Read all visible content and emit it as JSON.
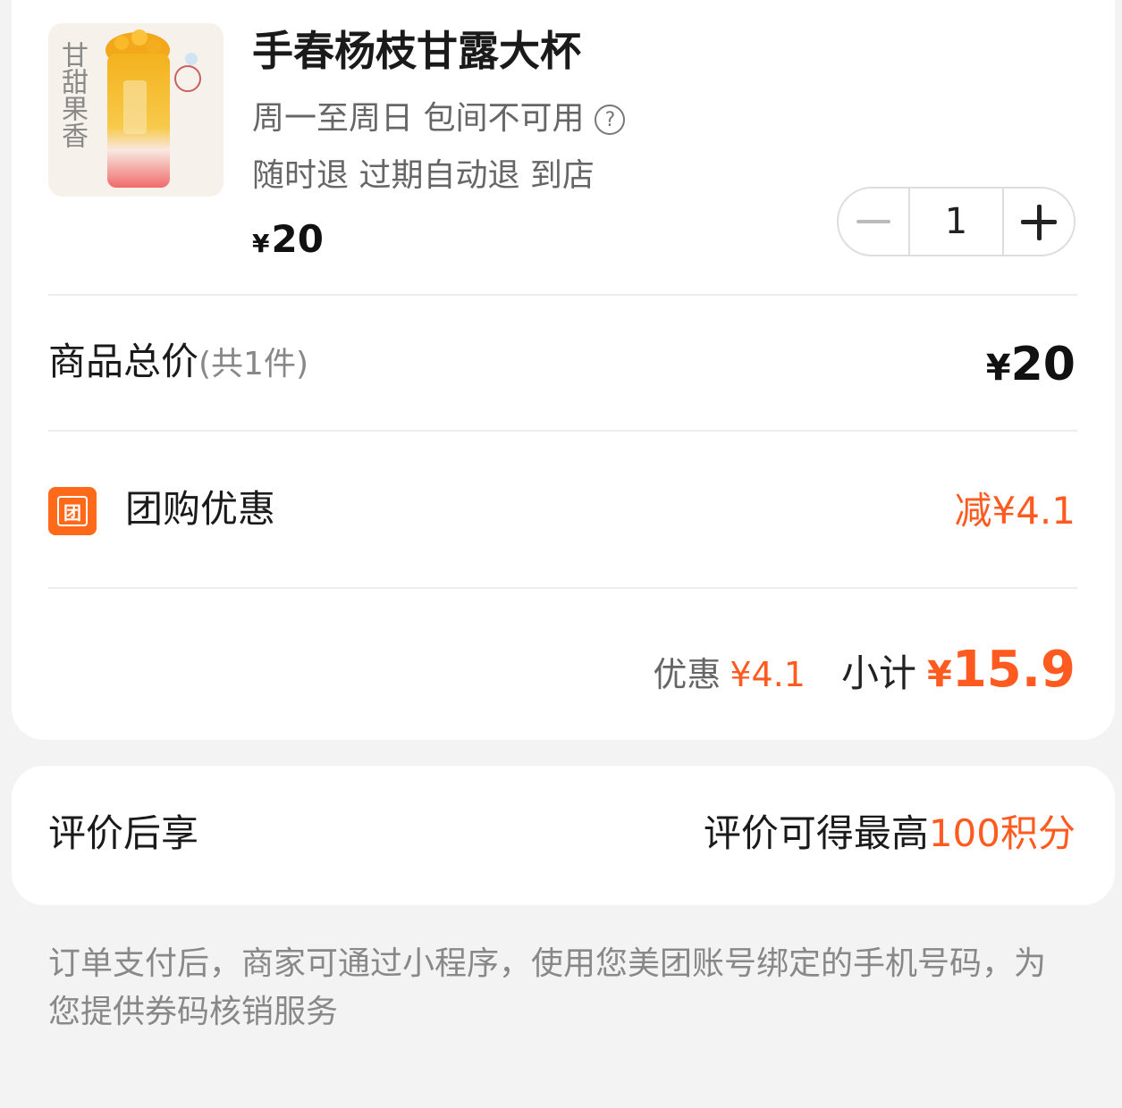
{
  "product": {
    "title": "手春杨枝甘露大杯",
    "validity": "周一至周日 包间不可用",
    "refund_policy": "随时退 过期自动退 到店",
    "price_symbol": "¥",
    "price": "20",
    "image_caption": "甘甜果香",
    "help_icon": "question-circle-icon"
  },
  "stepper": {
    "quantity": "1"
  },
  "total": {
    "label": "商品总价",
    "count_note": "(共1件)",
    "symbol": "¥",
    "value": "20"
  },
  "group_discount": {
    "badge_text": "团",
    "label": "团购优惠",
    "value": "减¥4.1"
  },
  "summary": {
    "discount_label": "优惠",
    "discount_value": "¥4.1",
    "subtotal_label": "小计",
    "subtotal_symbol": "¥",
    "subtotal_value": "15.9"
  },
  "points": {
    "left_label": "评价后享",
    "right_text": "评价可得最高",
    "right_highlight": "100积分"
  },
  "note": "订单支付后，商家可通过小程序，使用您美团账号绑定的手机号码，为您提供券码核销服务",
  "colors": {
    "accent": "#ff5a1f",
    "badge": "#ff6a1a",
    "background": "#f3f3f3",
    "card": "#ffffff"
  }
}
